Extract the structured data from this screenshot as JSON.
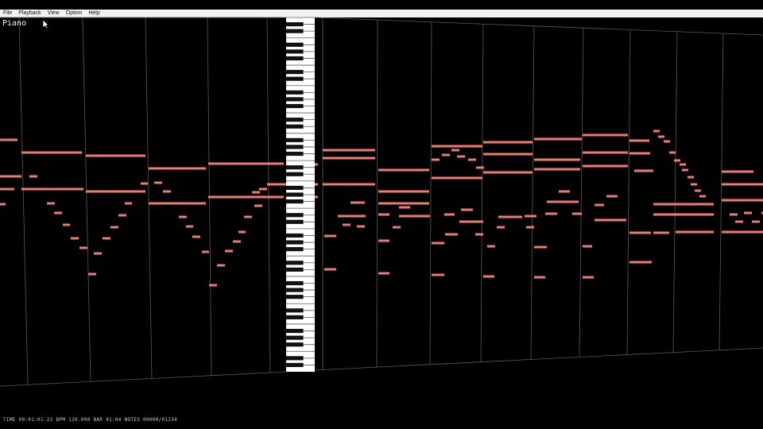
{
  "app": {
    "track_name": "Piano"
  },
  "menu": {
    "items": [
      {
        "label": "File"
      },
      {
        "label": "Playback"
      },
      {
        "label": "View"
      },
      {
        "label": "Option"
      },
      {
        "label": "Help"
      }
    ]
  },
  "colors": {
    "background": "#000000",
    "note": "#f07a72",
    "grid": "#5a5a5a",
    "keyboard_white": "#ffffff",
    "keyboard_black": "#111111"
  },
  "status": {
    "text": "TIME 00:01:01.23  BPM 120.000  BAR 41:04  NOTES 00000/01234"
  },
  "piano_roll": {
    "notes": [
      [
        0,
        176,
        22
      ],
      [
        0,
        222,
        27
      ],
      [
        0,
        238,
        18
      ],
      [
        0,
        257,
        7
      ],
      [
        27,
        192,
        76
      ],
      [
        27,
        238,
        78
      ],
      [
        37,
        222,
        10
      ],
      [
        59,
        256,
        10
      ],
      [
        68,
        268,
        10
      ],
      [
        79,
        283,
        9
      ],
      [
        89,
        300,
        10
      ],
      [
        100,
        312,
        10
      ],
      [
        111,
        345,
        10
      ],
      [
        108,
        196,
        75
      ],
      [
        108,
        241,
        75
      ],
      [
        118,
        319,
        10
      ],
      [
        129,
        300,
        10
      ],
      [
        139,
        286,
        10
      ],
      [
        149,
        271,
        10
      ],
      [
        157,
        256,
        9
      ],
      [
        177,
        231,
        9
      ],
      [
        187,
        212,
        72
      ],
      [
        187,
        256,
        72
      ],
      [
        194,
        230,
        10
      ],
      [
        205,
        241,
        10
      ],
      [
        225,
        273,
        10
      ],
      [
        234,
        285,
        9
      ],
      [
        242,
        298,
        10
      ],
      [
        254,
        317,
        9
      ],
      [
        263,
        359,
        10
      ],
      [
        273,
        334,
        10
      ],
      [
        283,
        316,
        10
      ],
      [
        293,
        304,
        10
      ],
      [
        300,
        292,
        9
      ],
      [
        307,
        273,
        10
      ],
      [
        320,
        259,
        10
      ],
      [
        317,
        242,
        10
      ],
      [
        326,
        238,
        10
      ],
      [
        262,
        206,
        95
      ],
      [
        262,
        248,
        95
      ],
      [
        336,
        232,
        60
      ],
      [
        380,
        207,
        20
      ],
      [
        380,
        232,
        20
      ],
      [
        380,
        248,
        20
      ],
      [
        380,
        260,
        10
      ],
      [
        380,
        292,
        10
      ],
      [
        386,
        300,
        10
      ],
      [
        406,
        189,
        66
      ],
      [
        406,
        199,
        66
      ],
      [
        406,
        232,
        66
      ],
      [
        408,
        297,
        15
      ],
      [
        408,
        339,
        15
      ],
      [
        425,
        272,
        15
      ],
      [
        431,
        283,
        10
      ],
      [
        440,
        272,
        20
      ],
      [
        441,
        255,
        18
      ],
      [
        449,
        285,
        10
      ],
      [
        476,
        214,
        64
      ],
      [
        476,
        241,
        64
      ],
      [
        476,
        256,
        64
      ],
      [
        476,
        270,
        14
      ],
      [
        476,
        303,
        14
      ],
      [
        476,
        344,
        14
      ],
      [
        494,
        286,
        10
      ],
      [
        502,
        272,
        14
      ],
      [
        502,
        261,
        14
      ],
      [
        516,
        272,
        25
      ],
      [
        543,
        184,
        64
      ],
      [
        543,
        224,
        64
      ],
      [
        543,
        201,
        10
      ],
      [
        543,
        306,
        16
      ],
      [
        543,
        346,
        16
      ],
      [
        556,
        195,
        10
      ],
      [
        568,
        189,
        10
      ],
      [
        575,
        197,
        10
      ],
      [
        589,
        201,
        10
      ],
      [
        599,
        211,
        10
      ],
      [
        559,
        270,
        13
      ],
      [
        560,
        295,
        16
      ],
      [
        578,
        279,
        30
      ],
      [
        580,
        264,
        15
      ],
      [
        598,
        295,
        10
      ],
      [
        608,
        179,
        62
      ],
      [
        608,
        194,
        62
      ],
      [
        608,
        217,
        62
      ],
      [
        608,
        348,
        14
      ],
      [
        613,
        310,
        10
      ],
      [
        625,
        286,
        10
      ],
      [
        627,
        273,
        30
      ],
      [
        660,
        272,
        15
      ],
      [
        662,
        286,
        10
      ],
      [
        672,
        175,
        60
      ],
      [
        672,
        201,
        58
      ],
      [
        672,
        213,
        58
      ],
      [
        672,
        349,
        14
      ],
      [
        672,
        311,
        16
      ],
      [
        686,
        269,
        15
      ],
      [
        703,
        241,
        14
      ],
      [
        688,
        254,
        40
      ],
      [
        720,
        269,
        12
      ],
      [
        733,
        170,
        57
      ],
      [
        733,
        192,
        57
      ],
      [
        733,
        209,
        57
      ],
      [
        733,
        349,
        14
      ],
      [
        733,
        310,
        12
      ],
      [
        748,
        258,
        12
      ],
      [
        763,
        247,
        14
      ],
      [
        748,
        277,
        40
      ],
      [
        764,
        192,
        12
      ],
      [
        792,
        177,
        25
      ],
      [
        792,
        193,
        26
      ],
      [
        792,
        293,
        27
      ],
      [
        792,
        330,
        28
      ],
      [
        798,
        215,
        24
      ],
      [
        822,
        165,
        8
      ],
      [
        828,
        172,
        8
      ],
      [
        835,
        178,
        8
      ],
      [
        842,
        192,
        8
      ],
      [
        848,
        202,
        8
      ],
      [
        855,
        207,
        8
      ],
      [
        858,
        214,
        8
      ],
      [
        865,
        223,
        8
      ],
      [
        869,
        232,
        8
      ],
      [
        874,
        240,
        8
      ],
      [
        880,
        247,
        8
      ],
      [
        822,
        257,
        30
      ],
      [
        822,
        270,
        50
      ],
      [
        822,
        293,
        20
      ],
      [
        850,
        257,
        48
      ],
      [
        850,
        270,
        48
      ],
      [
        850,
        292,
        48
      ],
      [
        908,
        216,
        40
      ],
      [
        908,
        232,
        52
      ],
      [
        908,
        252,
        52
      ],
      [
        908,
        292,
        52
      ],
      [
        918,
        270,
        10
      ],
      [
        925,
        279,
        10
      ],
      [
        936,
        268,
        10
      ],
      [
        946,
        279,
        10
      ],
      [
        958,
        268,
        8
      ]
    ]
  }
}
